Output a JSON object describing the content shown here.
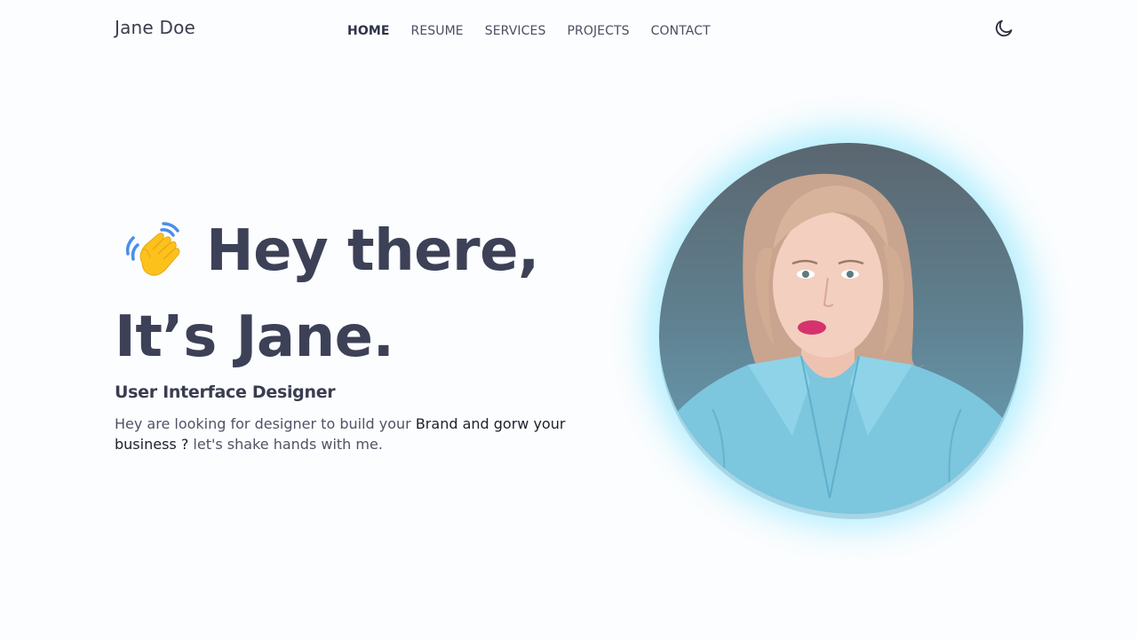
{
  "header": {
    "brand": "Jane Doe",
    "nav": [
      {
        "label": "HOME",
        "active": true
      },
      {
        "label": "RESUME",
        "active": false
      },
      {
        "label": "SERVICES",
        "active": false
      },
      {
        "label": "PROJECTS",
        "active": false
      },
      {
        "label": "CONTACT",
        "active": false
      }
    ],
    "theme_icon": "moon-icon"
  },
  "hero": {
    "greeting_icon": "waving-hand-icon",
    "line1": "Hey there,",
    "line2": "It’s Jane.",
    "role": "User Interface Designer",
    "tagline_part1": "Hey are looking for designer to build your ",
    "tagline_part2": "Brand and gorw your business ? ",
    "tagline_part3": "let's shake hands with me.",
    "portrait_icon": "profile-photo"
  },
  "colors": {
    "background": "#fcfdfe",
    "text": "#3d4157",
    "glow": "#50dcff"
  }
}
